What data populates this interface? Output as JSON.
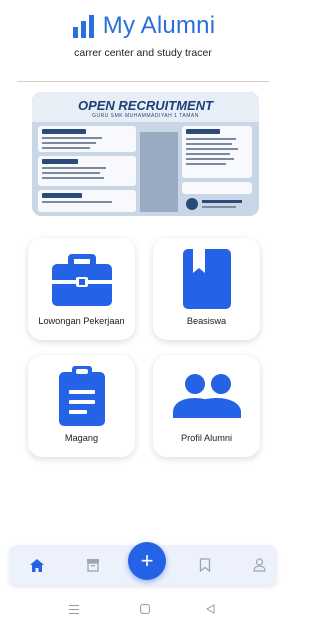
{
  "header": {
    "app_title": "My Alumni",
    "subtitle": "carrer center and study tracer"
  },
  "banner": {
    "title": "OPEN RECRUITMENT",
    "subtitle": "GURU SMK MUHAMMADIYAH 1 TAMAN"
  },
  "menu": {
    "lowongan": "Lowongan Pekerjaan",
    "beasiswa": "Beasiswa",
    "magang": "Magang",
    "profil": "Profil Alumni"
  },
  "bottom_nav": {
    "fab_label": "+",
    "items": [
      "home-icon",
      "archive-icon",
      "bookmark-icon",
      "person-icon"
    ]
  },
  "colors": {
    "primary": "#2463e6",
    "title_blue": "#2a6fdb",
    "nav_background": "#edf1fb"
  }
}
